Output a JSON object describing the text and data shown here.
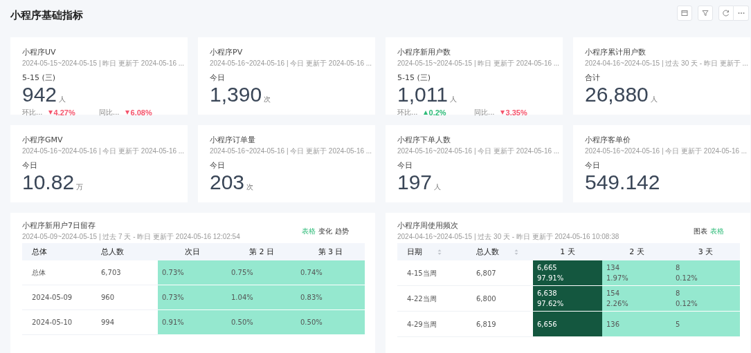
{
  "page": {
    "title": "小程序基础指标"
  },
  "metric_cards": [
    {
      "title": "小程序UV",
      "meta": "2024-05-15~2024-05-15 | 昨日 更新于 2024-05-16 ...",
      "period": "5-15 (三)",
      "value": "942",
      "unit": "人",
      "comparisons": [
        {
          "label": "环比...",
          "value": "4.27%",
          "kind": "down"
        },
        {
          "label": "同比...",
          "value": "6.08%",
          "kind": "down"
        }
      ]
    },
    {
      "title": "小程序PV",
      "meta": "2024-05-16~2024-05-16 | 今日 更新于 2024-05-16 ...",
      "period": "今日",
      "value": "1,390",
      "unit": "次"
    },
    {
      "title": "小程序新用户数",
      "meta": "2024-05-15~2024-05-15 | 昨日 更新于 2024-05-16 ...",
      "period": "5-15 (三)",
      "value": "1,011",
      "unit": "人",
      "comparisons": [
        {
          "label": "环比...",
          "value": "0.2%",
          "kind": "up"
        },
        {
          "label": "同比...",
          "value": "3.35%",
          "kind": "down"
        }
      ]
    },
    {
      "title": "小程序累计用户数",
      "meta": "2024-04-16~2024-05-15 | 过去 30 天 - 昨日 更新于 ...",
      "period": "合计",
      "value": "26,880",
      "unit": "人"
    },
    {
      "title": "小程序GMV",
      "meta": "2024-05-16~2024-05-16 | 今日 更新于 2024-05-16 ...",
      "period": "今日",
      "value": "10.82",
      "unit": "万"
    },
    {
      "title": "小程序订单量",
      "meta": "2024-05-16~2024-05-16 | 今日 更新于 2024-05-16 ...",
      "period": "今日",
      "value": "203",
      "unit": "次"
    },
    {
      "title": "小程序下单人数",
      "meta": "2024-05-16~2024-05-16 | 今日 更新于 2024-05-16 ...",
      "period": "今日",
      "value": "197",
      "unit": "人"
    },
    {
      "title": "小程序客单价",
      "meta": "2024-05-16~2024-05-16 | 今日 更新于 2024-05-16 ...",
      "period": "今日",
      "value": "549.142"
    }
  ],
  "table_panels": [
    {
      "title": "小程序新用户7日留存",
      "meta": "2024-05-09~2024-05-15 | 过去 7 天 - 昨日 更新于 2024-05-16 12:02:54",
      "view_switch": [
        {
          "label": "表格",
          "selected": true
        },
        {
          "label": "变化",
          "selected": false
        },
        {
          "label": "趋势",
          "selected": false
        }
      ],
      "columns": [
        {
          "label": "总体",
          "sortable": false
        },
        {
          "label": "总人数",
          "sortable": false
        },
        {
          "label": "次日",
          "sortable": false
        },
        {
          "label": "第 2 日",
          "sortable": false
        },
        {
          "label": "第 3 日",
          "sortable": false
        }
      ],
      "rows": [
        {
          "cells": [
            {
              "lines": [
                "总体"
              ]
            },
            {
              "lines": [
                "6,703"
              ]
            },
            {
              "lines": [
                "0.73%"
              ],
              "color": "#95e8cf"
            },
            {
              "lines": [
                "0.75%"
              ],
              "color": "#95e8cf"
            },
            {
              "lines": [
                "0.74%"
              ],
              "color": "#95e8cf"
            }
          ]
        },
        {
          "cells": [
            {
              "lines": [
                "2024-05-09"
              ]
            },
            {
              "lines": [
                "960"
              ]
            },
            {
              "lines": [
                "0.73%"
              ],
              "color": "#95e8cf"
            },
            {
              "lines": [
                "1.04%"
              ],
              "color": "#95e8cf"
            },
            {
              "lines": [
                "0.83%"
              ],
              "color": "#95e8cf"
            }
          ]
        },
        {
          "cells": [
            {
              "lines": [
                "2024-05-10"
              ]
            },
            {
              "lines": [
                "994"
              ]
            },
            {
              "lines": [
                "0.91%"
              ],
              "color": "#95e8cf"
            },
            {
              "lines": [
                "0.50%"
              ],
              "color": "#95e8cf"
            },
            {
              "lines": [
                "0.50%"
              ],
              "color": "#95e8cf"
            }
          ]
        }
      ]
    },
    {
      "title": "小程序周使用频次",
      "meta": "2024-04-16~2024-05-15 | 过去 30 天 - 昨日 更新于 2024-05-16 10:08:38",
      "view_switch": [
        {
          "label": "图表",
          "selected": false
        },
        {
          "label": "表格",
          "selected": true
        }
      ],
      "columns": [
        {
          "label": "日期",
          "sortable": true
        },
        {
          "label": "总人数",
          "sortable": true
        },
        {
          "label": "1 天",
          "sortable": false
        },
        {
          "label": "2 天",
          "sortable": false
        },
        {
          "label": "3 天",
          "sortable": false
        }
      ],
      "rows": [
        {
          "cells": [
            {
              "lines": [
                "4-15当周"
              ]
            },
            {
              "lines": [
                "6,807"
              ]
            },
            {
              "lines": [
                "6,665",
                "97.91%"
              ],
              "color": "#14573f"
            },
            {
              "lines": [
                "134",
                "1.97%"
              ],
              "color": "#95e8cf"
            },
            {
              "lines": [
                "8",
                "0.12%"
              ],
              "color": "#95e8cf"
            }
          ]
        },
        {
          "cells": [
            {
              "lines": [
                "4-22当周"
              ]
            },
            {
              "lines": [
                "6,800"
              ]
            },
            {
              "lines": [
                "6,638",
                "97.62%"
              ],
              "color": "#14573f"
            },
            {
              "lines": [
                "154",
                "2.26%"
              ],
              "color": "#95e8cf"
            },
            {
              "lines": [
                "8",
                "0.12%"
              ],
              "color": "#95e8cf"
            }
          ]
        },
        {
          "cells": [
            {
              "lines": [
                "4-29当周"
              ]
            },
            {
              "lines": [
                "6,819"
              ]
            },
            {
              "lines": [
                "6,656"
              ],
              "color": "#14573f"
            },
            {
              "lines": [
                "136"
              ],
              "color": "#95e8cf"
            },
            {
              "lines": [
                "5"
              ],
              "color": "#95e8cf"
            }
          ]
        }
      ]
    }
  ]
}
